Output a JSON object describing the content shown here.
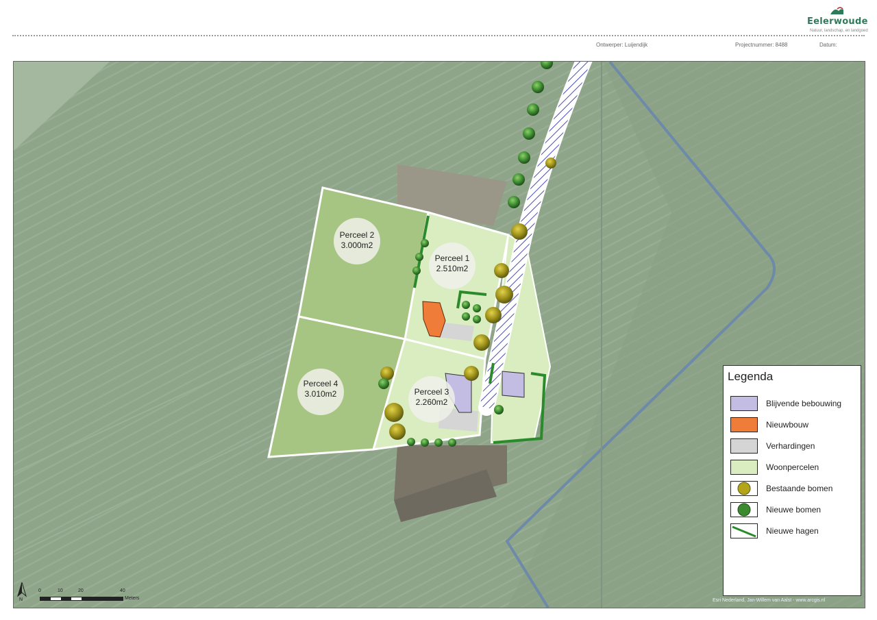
{
  "header": {
    "brand": "Eelerwoude",
    "tagline": "Natuur, landschap, en landgoed",
    "designer": "Ontwerper: Luijendijk",
    "project_number": "Projectnummer: 8488",
    "date_label": "Datum:"
  },
  "map": {
    "plots": [
      {
        "name": "Perceel 1",
        "area": "2.510m2"
      },
      {
        "name": "Perceel 2",
        "area": "3.000m2"
      },
      {
        "name": "Perceel 3",
        "area": "2.260m2"
      },
      {
        "name": "Perceel 4",
        "area": "3.010m2"
      }
    ],
    "north_label": "N",
    "scale": {
      "ticks": [
        "0",
        "10",
        "20",
        "40"
      ],
      "unit": "Meters"
    },
    "copyright": "Esri Nederland, Jan-Willem van Aalst - www.arcgis.nl"
  },
  "legend": {
    "title": "Legenda",
    "items": [
      {
        "label": "Blijvende bebouwing",
        "icon": "building-swatch",
        "color": "#c3bde3"
      },
      {
        "label": "Nieuwbouw",
        "icon": "new-building-swatch",
        "color": "#f07c39"
      },
      {
        "label": "Verhardingen",
        "icon": "pavement-swatch",
        "color": "#d5d5d5"
      },
      {
        "label": "Woonpercelen",
        "icon": "residential-plot-swatch",
        "color": "#d9edc1"
      },
      {
        "label": "Bestaande bomen",
        "icon": "existing-tree-icon",
        "color": "#b4a419"
      },
      {
        "label": "Nieuwe bomen",
        "icon": "new-tree-icon",
        "color": "#3c8a30"
      },
      {
        "label": "Nieuwe hagen",
        "icon": "new-hedge-icon",
        "color": "#2b8a2b"
      }
    ]
  },
  "colors": {
    "field": "#8fa58a",
    "plot_green": "#a7c582",
    "plot_light": "#d9edc1",
    "plot_border": "#ffffff",
    "new_build": "#f07c39",
    "existing_build": "#c3bde3",
    "hedge": "#2b8a2b",
    "path_stripe": "#4a4fb5",
    "brand": "#2e7b5c"
  }
}
